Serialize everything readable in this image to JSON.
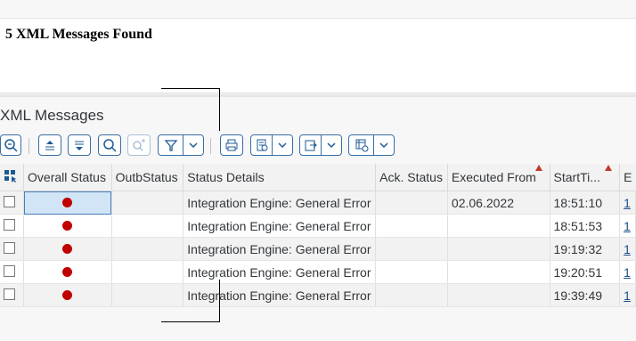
{
  "header": {
    "found_text": "5 XML Messages Found"
  },
  "section": {
    "title": "XML Messages"
  },
  "toolbar": {
    "icons": [
      "zoom-detail-icon",
      "sort-ascending-icon",
      "sort-descending-icon",
      "find-icon",
      "find-next-icon",
      "filter-icon",
      "print-icon",
      "view-icon",
      "export-icon",
      "settings-icon"
    ]
  },
  "table": {
    "columns": [
      "Overall Status",
      "OutbStatus",
      "Status Details",
      "Ack. Status",
      "Executed From",
      "StartTi...",
      "E"
    ],
    "rows": [
      {
        "status_details": "Integration Engine: General Error",
        "executed_from": "02.06.2022",
        "start_time": "18:51:10",
        "e": "1"
      },
      {
        "status_details": "Integration Engine: General Error",
        "executed_from": "",
        "start_time": "18:51:53",
        "e": "1"
      },
      {
        "status_details": "Integration Engine: General Error",
        "executed_from": "",
        "start_time": "19:19:32",
        "e": "1"
      },
      {
        "status_details": "Integration Engine: General Error",
        "executed_from": "",
        "start_time": "19:20:51",
        "e": "1"
      },
      {
        "status_details": "Integration Engine: General Error",
        "executed_from": "",
        "start_time": "19:39:49",
        "e": "1"
      }
    ],
    "status_color": "#c00000",
    "selected_color": "#d1e5f7"
  }
}
